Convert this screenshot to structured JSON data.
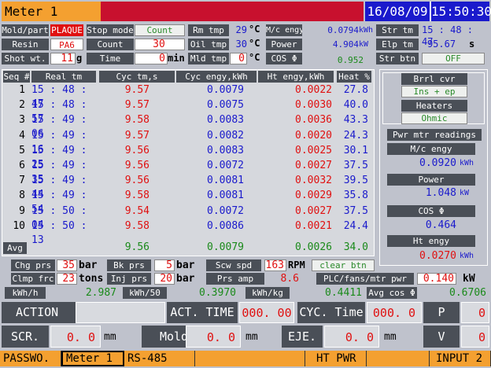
{
  "header": {
    "title": "Meter 1",
    "date": "16/08/09",
    "time": "15:50:30"
  },
  "params": {
    "mold_label": "Mold/part",
    "mold_value": "PLAQUE",
    "resin_label": "Resin",
    "resin_value": "PA6",
    "shot_label": "Shot wt.",
    "shot_value": "11",
    "shot_unit": "g",
    "stop_mode_label": "Stop mode",
    "stop_mode_value": "Count",
    "count_label": "Count",
    "count_value": "30",
    "count_extra": "---",
    "time_label": "Time",
    "time_value": "0",
    "time_unit": "min",
    "rm_tmp_label": "Rm tmp",
    "rm_tmp_value": "29",
    "rm_tmp_unit": "°C",
    "oil_tmp_label": "Oil tmp",
    "oil_tmp_value": "30",
    "oil_tmp_unit": "°C",
    "mld_tmp_label": "Mld tmp",
    "mld_tmp_value": "0",
    "mld_tmp_unit": "°C",
    "mc_engy_label": "M/c engy",
    "mc_engy_value": "0.0794",
    "mc_engy_unit": "kWh",
    "power_label": "Power",
    "power_value": "4.904",
    "power_unit": "kW",
    "cos_label": "COS Φ",
    "cos_value": "0.952",
    "str_tm_label": "Str tm",
    "str_tm_value": "15 : 48 : 47",
    "elp_tm_label": "Elp tm",
    "elp_tm_value": "95.67",
    "elp_tm_unit": "s",
    "str_btn_label": "Str btn",
    "str_btn_value": "OFF"
  },
  "table": {
    "headers": [
      "Seq #",
      "Real tm",
      "Cyc tm,s",
      "Cyc engy,kWh",
      "Ht engy,kWh",
      "Heat %"
    ],
    "rows": [
      [
        "1",
        "15 : 48 : 47",
        "9.57",
        "0.0079",
        "0.0022",
        "27.8"
      ],
      [
        "2",
        "15 : 48 : 57",
        "9.57",
        "0.0075",
        "0.0030",
        "40.0"
      ],
      [
        "3",
        "15 : 49 : 06",
        "9.58",
        "0.0083",
        "0.0036",
        "43.3"
      ],
      [
        "4",
        "15 : 49 : 16",
        "9.57",
        "0.0082",
        "0.0020",
        "24.3"
      ],
      [
        "5",
        "15 : 49 : 25",
        "9.56",
        "0.0083",
        "0.0025",
        "30.1"
      ],
      [
        "6",
        "15 : 49 : 35",
        "9.56",
        "0.0072",
        "0.0027",
        "37.5"
      ],
      [
        "7",
        "15 : 49 : 44",
        "9.56",
        "0.0081",
        "0.0032",
        "39.5"
      ],
      [
        "8",
        "15 : 49 : 54",
        "9.58",
        "0.0081",
        "0.0029",
        "35.8"
      ],
      [
        "9",
        "15 : 50 : 04",
        "9.54",
        "0.0072",
        "0.0027",
        "37.5"
      ],
      [
        "10",
        "15 : 50 : 13",
        "9.58",
        "0.0086",
        "0.0021",
        "24.4"
      ]
    ],
    "avg_label": "Avg",
    "avg": [
      "9.56",
      "0.0079",
      "0.0026",
      "34.0"
    ]
  },
  "side": {
    "brrl_cvr_label": "Brrl cvr",
    "brrl_cvr_value": "Ins + ep",
    "heaters_label": "Heaters",
    "heaters_value": "Ohmic",
    "pwr_mtr_label": "Pwr mtr readings",
    "mc_engy_label": "M/c engy",
    "mc_engy_value": "0.0920",
    "mc_engy_unit": "kWh",
    "power_label": "Power",
    "power_value": "1.048",
    "power_unit": "kW",
    "cos_label": "COS Φ",
    "cos_value": "0.464",
    "ht_engy_label": "Ht engy",
    "ht_engy_value": "0.0270",
    "ht_engy_unit": "kWh"
  },
  "lower": {
    "chg_prs_label": "Chg prs",
    "chg_prs_value": "35",
    "chg_prs_unit": "bar",
    "bk_prs_label": "Bk prs",
    "bk_prs_value": "5",
    "bk_prs_unit": "bar",
    "scw_spd_label": "Scw spd",
    "scw_spd_value": "163",
    "scw_spd_unit": "RPM",
    "clear_btn": "clear btn",
    "clmp_frc_label": "Clmp frc",
    "clmp_frc_value": "23",
    "clmp_frc_unit": "tons",
    "inj_prs_label": "Inj prs",
    "inj_prs_value": "20",
    "inj_prs_unit": "bar",
    "prs_amp_label": "Prs amp",
    "prs_amp_value": "8.6",
    "plc_label": "PLC/fans/mtr pwr",
    "plc_value": "0.140",
    "plc_unit": "kW",
    "kwh_h_label": "kWh/h",
    "kwh_h_value": "2.987",
    "kwh_50_label": "kWh/50",
    "kwh_50_value": "0.3970",
    "kwh_kg_label": "kWh/kg",
    "kwh_kg_value": "0.4411",
    "avg_cos_label": "Avg cos Φ",
    "avg_cos_value": "0.6706"
  },
  "status": {
    "action_label": "ACTION",
    "act_time_label": "ACT. TIME",
    "act_time_value": "000. 00",
    "cyc_time_label": "CYC. Time",
    "cyc_time_value": "000. 0",
    "p_label": "P",
    "p_value": "0",
    "scr_label": "SCR.",
    "scr_value": "0. 0",
    "scr_unit": "mm",
    "mold_label": "Mold",
    "mold_value": "0. 0",
    "mold_unit": "mm",
    "eje_label": "EJE.",
    "eje_value": "0. 0",
    "eje_unit": "mm",
    "v_label": "V",
    "v_value": "0"
  },
  "tabs": [
    "PASSWO.",
    "Meter 1",
    "RS-485",
    "",
    "HT PWR",
    "",
    "INPUT 2"
  ]
}
